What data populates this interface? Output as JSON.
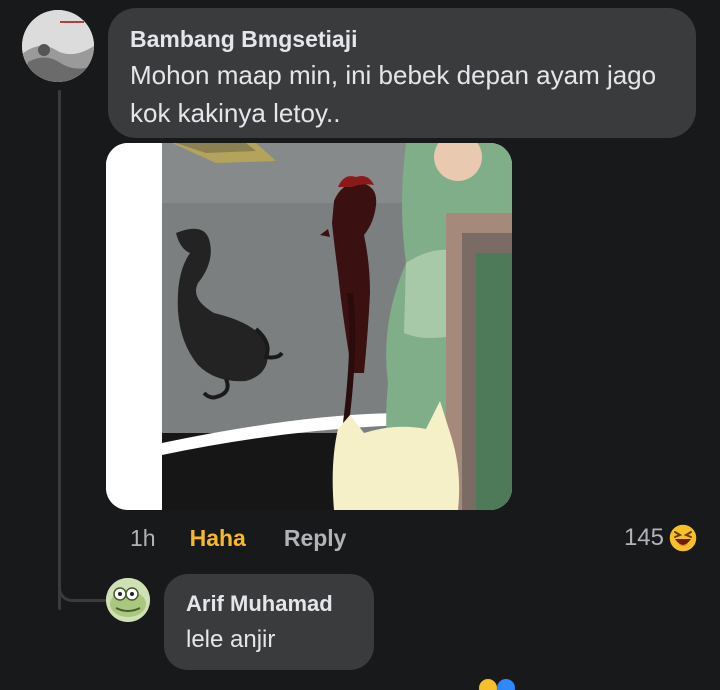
{
  "comment": {
    "author": "Bambang Bmgsetiaji",
    "text": "Mohon maap min, ini bebek depan ayam jago kok kakinya letoy..",
    "avatar_icon": "profile-photo-icon",
    "attachment": "cartoon-duck-and-rooster-image",
    "time": "1h",
    "reaction_label": "Haha",
    "reply_label": "Reply",
    "reaction_count": "145",
    "reaction_icon": "haha-emoji-icon",
    "reaction_color": "#f7b928"
  },
  "reply": {
    "author": "Arif Muhamad",
    "text": "lele anjir",
    "avatar_icon": "cartoon-avatar-icon"
  },
  "colors": {
    "background": "#18191a",
    "bubble": "#3a3b3c",
    "text": "#e4e6eb",
    "muted": "#b0b3b8"
  }
}
